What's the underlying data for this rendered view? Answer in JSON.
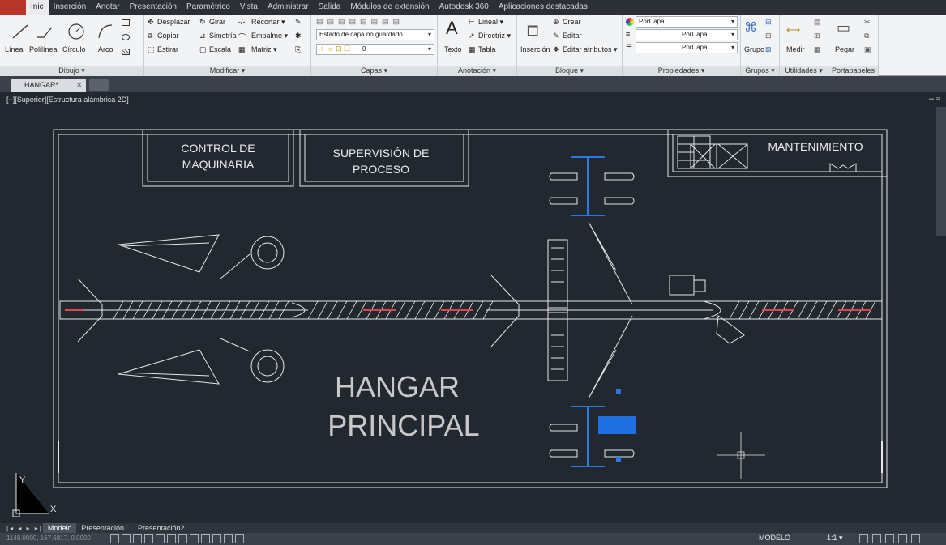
{
  "ribbon_tabs": [
    "Inic",
    "Inserción",
    "Anotar",
    "Presentación",
    "Paramétrico",
    "Vista",
    "Administrar",
    "Salida",
    "Módulos de extensión",
    "Autodesk 360",
    "Aplicaciones destacadas"
  ],
  "active_tab": "Inic",
  "panels": {
    "dibujo": {
      "title": "Dibujo ▾",
      "linea": "Línea",
      "polilinea": "Polilínea",
      "circulo": "Círculo",
      "arco": "Arco"
    },
    "modificar": {
      "title": "Modificar ▾",
      "desplazar": "Desplazar",
      "girar": "Girar",
      "recortar": "Recortar ▾",
      "copiar": "Copiar",
      "simetria": "Simetría",
      "empalme": "Empalme ▾",
      "estirar": "Estirar",
      "escala": "Escala",
      "matriz": "Matriz ▾"
    },
    "capas": {
      "title": "Capas ▾",
      "estado": "Estado de capa no guardado",
      "capa_actual": "0"
    },
    "anotacion": {
      "title": "Anotación ▾",
      "texto": "Texto",
      "lineal": "Lineal ▾",
      "directriz": "Directriz ▾",
      "tabla": "Tabla"
    },
    "bloque": {
      "title": "Bloque ▾",
      "insercion": "Inserción",
      "crear": "Crear",
      "editar": "Editar",
      "editar_atributos": "Editar atributos ▾"
    },
    "propiedades": {
      "title": "Propiedades ▾",
      "color": "PorCapa",
      "tipo_linea": "PorCapa",
      "grosor": "PorCapa"
    },
    "grupos": {
      "title": "Grupos ▾",
      "grupo": "Grupo"
    },
    "utilidades": {
      "title": "Utilidades ▾",
      "medir": "Medir"
    },
    "portapapeles": {
      "title": "Portapapeles",
      "pegar": "Pegar"
    }
  },
  "file_tab": "HANGAR*",
  "viewport_label": "[−][Superior][Estructura alámbrica 2D]",
  "drawing": {
    "rooms": [
      "CONTROL DE",
      "MAQUINARIA",
      "SUPERVISIÓN DE",
      "PROCESO",
      "MANTENIMIENTO"
    ],
    "title_line1": "HANGAR",
    "title_line2": "PRINCIPAL",
    "ucs_y": "Y",
    "ucs_x": "X"
  },
  "layout_tabs": [
    "Modelo",
    "Presentación1",
    "Presentación2"
  ],
  "active_layout": "Modelo",
  "status": {
    "coords": "1148.0000, 167.6817, 0.0000",
    "model": "MODELO",
    "scale": "1:1 ▾"
  },
  "colors": {
    "canvas": "#212830",
    "lines": "#e8e8e8",
    "red_marks": "#e0454a",
    "selection": "#1f6fe0",
    "app_button": "#b8352c"
  }
}
